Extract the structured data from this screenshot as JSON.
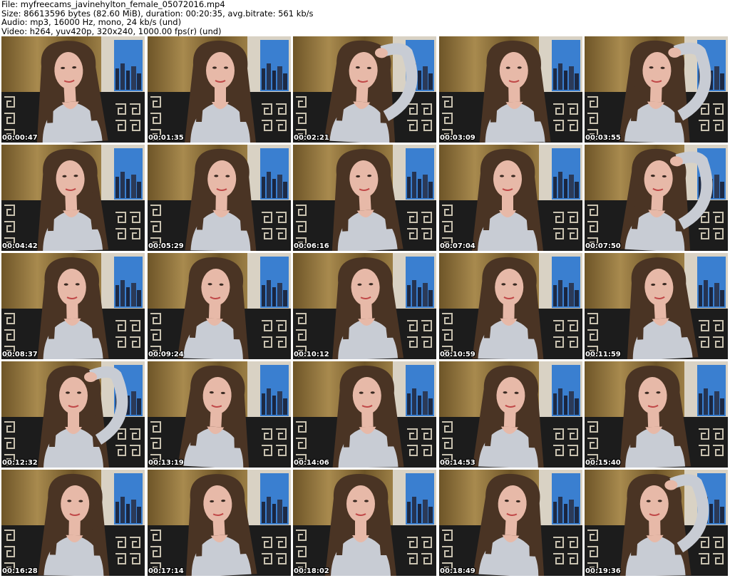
{
  "header": {
    "file_line": "File: myfreecams_javinehylton_female_05072016.mp4",
    "size_line": "Size: 86613596 bytes (82.60 MiB), duration: 00:20:35, avg.bitrate: 561 kb/s",
    "audio_line": "Audio: mp3, 16000 Hz, mono, 24 kb/s (und)",
    "video_line": "Video: h264, yuv420p, 320x240, 1000.00 fps(r) (und)"
  },
  "thumbnails": [
    {
      "timestamp": "00:00:47"
    },
    {
      "timestamp": "00:01:35"
    },
    {
      "timestamp": "00:02:21"
    },
    {
      "timestamp": "00:03:09"
    },
    {
      "timestamp": "00:03:55"
    },
    {
      "timestamp": "00:04:42"
    },
    {
      "timestamp": "00:05:29"
    },
    {
      "timestamp": "00:06:16"
    },
    {
      "timestamp": "00:07:04"
    },
    {
      "timestamp": "00:07:50"
    },
    {
      "timestamp": "00:08:37"
    },
    {
      "timestamp": "00:09:24"
    },
    {
      "timestamp": "00:10:12"
    },
    {
      "timestamp": "00:10:59"
    },
    {
      "timestamp": "00:11:59"
    },
    {
      "timestamp": "00:12:32"
    },
    {
      "timestamp": "00:13:19"
    },
    {
      "timestamp": "00:14:06"
    },
    {
      "timestamp": "00:14:53"
    },
    {
      "timestamp": "00:15:40"
    },
    {
      "timestamp": "00:16:28"
    },
    {
      "timestamp": "00:17:14"
    },
    {
      "timestamp": "00:18:02"
    },
    {
      "timestamp": "00:18:49"
    },
    {
      "timestamp": "00:19:36"
    }
  ],
  "colors": {
    "curtain": "#a88a4e",
    "curtain_dark": "#6e5528",
    "wall": "#d9d2c4",
    "poster_sky": "#3a7fd0",
    "sofa_dark": "#1c1c1c",
    "sofa_pattern": "#c9c2b0",
    "hair": "#4a3424",
    "skin": "#e7b9a8",
    "shirt": "#c8ccd4"
  }
}
